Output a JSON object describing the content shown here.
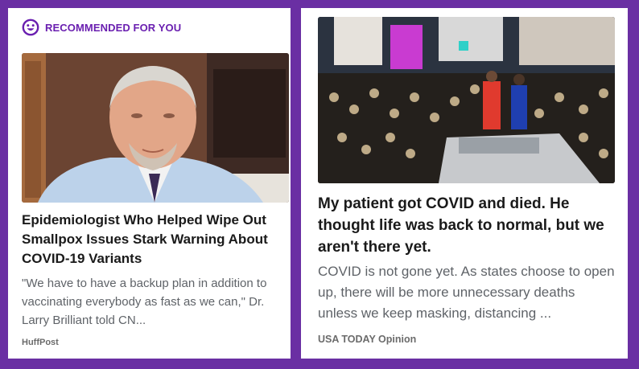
{
  "recommended": {
    "label": "RECOMMENDED FOR YOU",
    "icon": "smiley-icon",
    "accent": "#6a1fb0"
  },
  "colors": {
    "frame": "#6a2fa3",
    "card": "#ffffff",
    "headline": "#1a1a1a",
    "summary": "#5f6368"
  },
  "articles": [
    {
      "headline": "Epidemiologist Who Helped Wipe Out Smallpox Issues Stark Warning About COVID-19 Variants",
      "summary": "\"We have to have a backup plan in addition to vaccinating everybody as fast as we can,\" Dr. Larry Brilliant told CN...",
      "source": "HuffPost",
      "image": "man-portrait-photo"
    },
    {
      "headline": "My patient got COVID and died. He thought life was back to normal, but we aren't there yet.",
      "summary": "COVID is not gone yet. As states choose to open up, there will be more unnecessary deaths unless we keep masking, distancing ...",
      "source": "USA TODAY Opinion",
      "image": "night-crowd-photo"
    }
  ]
}
